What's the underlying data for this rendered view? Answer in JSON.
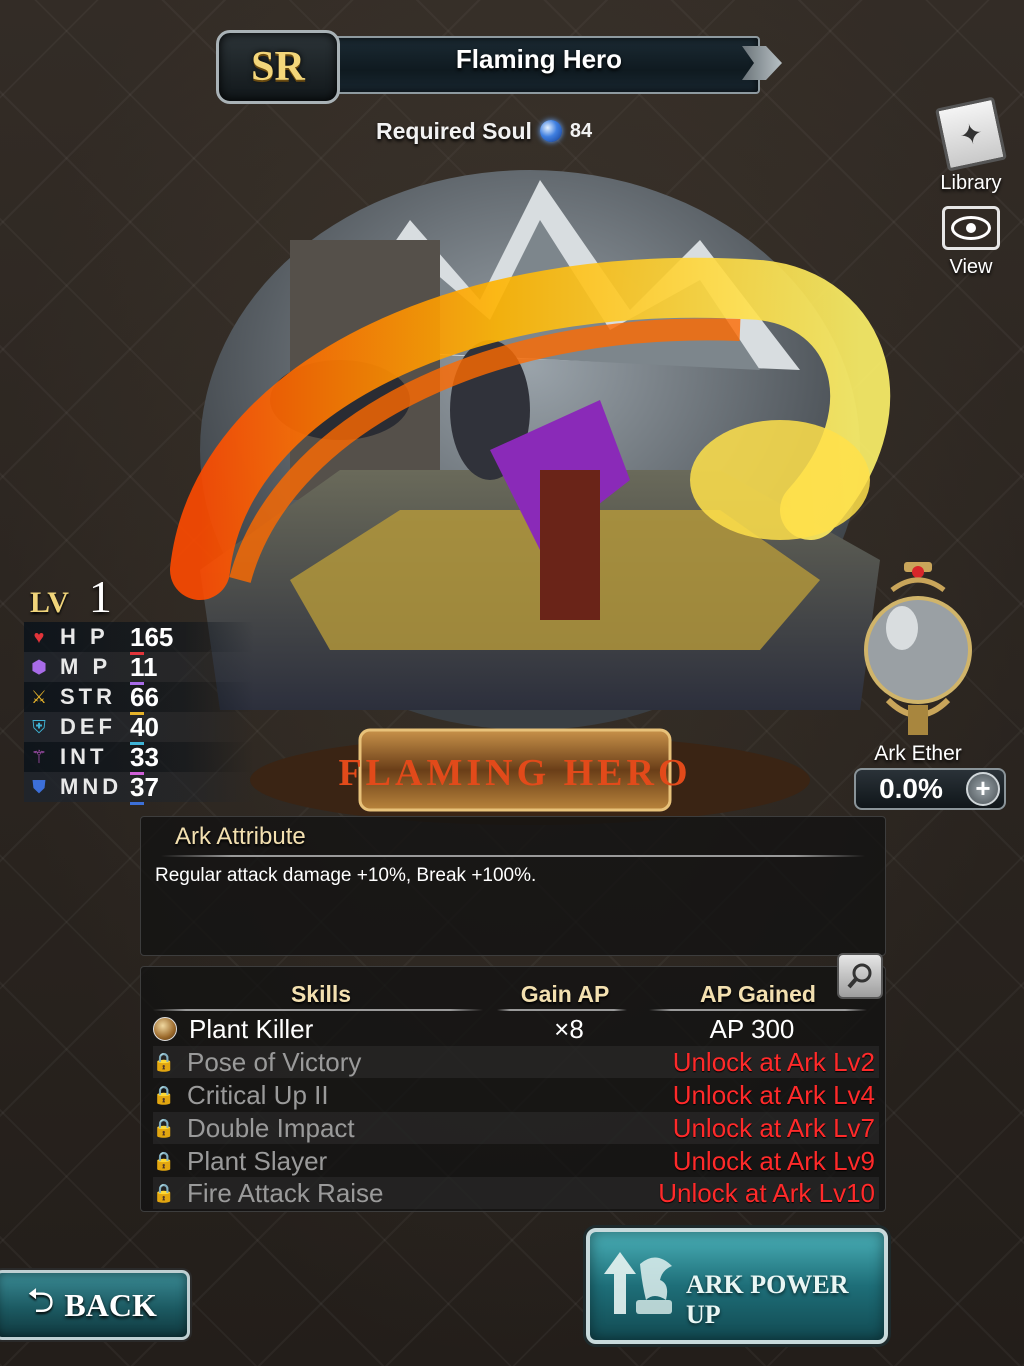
{
  "header": {
    "rarity": "SR",
    "card_name": "Flaming Hero"
  },
  "required_soul": {
    "label": "Required Soul",
    "value": "84"
  },
  "side_buttons": {
    "library_label": "Library",
    "view_label": "View"
  },
  "artwork": {
    "plaque_text": "FLAMING HERO",
    "description": "Flaming Hero diorama"
  },
  "level": {
    "label": "LV",
    "value": "1"
  },
  "stats": [
    {
      "name": "H P",
      "value": "165",
      "icon": "heart-icon"
    },
    {
      "name": "M P",
      "value": "11",
      "icon": "mp-crystal-icon"
    },
    {
      "name": "STR",
      "value": "66",
      "icon": "sword-icon"
    },
    {
      "name": "DEF",
      "value": "40",
      "icon": "shield-icon"
    },
    {
      "name": "INT",
      "value": "33",
      "icon": "staff-icon"
    },
    {
      "name": "MND",
      "value": "37",
      "icon": "mind-shield-icon"
    }
  ],
  "ark_ether": {
    "label": "Ark Ether",
    "value": "0.0%"
  },
  "ark_attribute": {
    "title": "Ark Attribute",
    "text": "Regular attack damage +10%, Break +100%."
  },
  "skills": {
    "headers": {
      "skills": "Skills",
      "gain_ap": "Gain AP",
      "ap_gained": "AP Gained"
    },
    "rows": [
      {
        "name": "Plant Killer",
        "gain": "×8",
        "ap": "AP 300",
        "locked": false
      },
      {
        "name": "Pose of Victory",
        "gain": "",
        "ap": "Unlock at Ark Lv2",
        "locked": true
      },
      {
        "name": "Critical Up II",
        "gain": "",
        "ap": "Unlock at Ark Lv4",
        "locked": true
      },
      {
        "name": "Double Impact",
        "gain": "",
        "ap": "Unlock at Ark Lv7",
        "locked": true
      },
      {
        "name": "Plant Slayer",
        "gain": "",
        "ap": "Unlock at Ark Lv9",
        "locked": true
      },
      {
        "name": "Fire Attack Raise",
        "gain": "",
        "ap": "Unlock at Ark Lv10",
        "locked": true
      }
    ]
  },
  "buttons": {
    "back": "BACK",
    "ark_power_up": "ARK POWER UP"
  },
  "colors": {
    "locked_text": "#ff2a2a",
    "accent_gold": "#f3d67a",
    "button_teal": "#1e6e78"
  }
}
